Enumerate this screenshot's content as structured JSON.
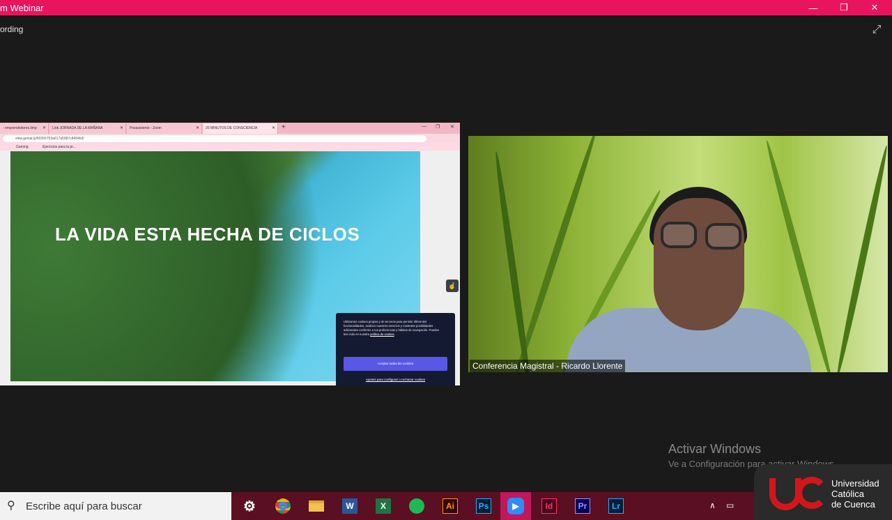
{
  "window": {
    "title": "m Webinar",
    "recording": "ording"
  },
  "browser": {
    "tabs": [
      {
        "label": "- emprendedores.ilmp-"
      },
      {
        "label": "Link JORNADA DE LA MAÑANA"
      },
      {
        "label": "Posasistente - Zoom"
      },
      {
        "label": "20 MINUTOS DE CONSCIENCIA"
      }
    ],
    "url": "view.genial.ly/60355753a617a5087c8494b3/",
    "bookmarks": [
      "Gaming",
      "Ejercicios para la pr..."
    ]
  },
  "slide": {
    "title": "LA VIDA ESTA HECHA DE CICLOS"
  },
  "cookie": {
    "text": "Utilizamos cookies propias y de terceros para permitir diferentes funcionalidades, analizar nuestros servicios y mostrarte posibilidades adicionales conforme a tus preferencias y hábitos de navegación. Puedes leer más en nuestra",
    "link": "política de cookies",
    "accept": "Aceptar todas las cookies",
    "settings": "Ajustes para configurar o rechazar cookies"
  },
  "video": {
    "label": "Conferencia Magistral - Ricardo Llorente"
  },
  "activation": {
    "line1": "Activar Windows",
    "line2": "Ve a Configuración para activar Windows."
  },
  "taskbar": {
    "search_placeholder": "Escribe aquí para buscar",
    "apps": [
      "Ai",
      "Ps",
      "Id",
      "Pr",
      "Lr",
      "W",
      "X"
    ]
  },
  "logo": {
    "line1": "Universidad",
    "line2": "Católica",
    "line3": "de Cuenca"
  },
  "colors": {
    "titlebar": "#e8155e",
    "taskbar": "#5a0f22",
    "accept_button": "#5659e6"
  }
}
